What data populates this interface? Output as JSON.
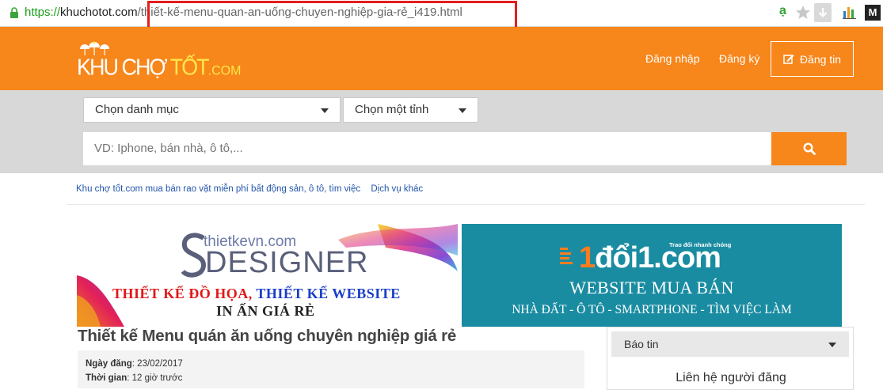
{
  "browser": {
    "url_scheme": "https://",
    "url_host": "khuchotot.com",
    "url_path": "/thiết-kế-menu-quan-an-uống-chuyen-nghiệp-gia-rẻ_i419.html"
  },
  "header": {
    "logo_main": "KHU CHỢ ",
    "logo_tot": "TỐT",
    "logo_com": ".COM",
    "login": "Đăng nhập",
    "register": "Đăng ký",
    "post": "Đăng tin"
  },
  "search": {
    "category_label": "Chọn danh mục",
    "province_label": "Chọn một tỉnh",
    "placeholder": "VD: Iphone, bán nhà, ô tô,..."
  },
  "breadcrumb": {
    "home": "Khu chợ tốt.com mua bán rao vặt miễn phí bất động sản, ô tô, tìm việc",
    "current": "Dịch vụ khác"
  },
  "banner_left": {
    "site": "thietkevn.com",
    "brand": "DESIGNER",
    "line1_red": "THIẾT KẾ ĐỒ HỌA, ",
    "line1_blue": "THIẾT KẾ WEBSITE",
    "line2": "IN ẤN GIÁ RẺ"
  },
  "banner_right": {
    "logo_a": "đổi",
    "logo_b": "1",
    "logo_c": ".com",
    "tagline": "Trao đổi nhanh chóng",
    "title": "WEBSITE MUA BÁN",
    "subtitle": "NHÀ ĐẤT - Ô TÔ - SMARTPHONE - TÌM VIỆC LÀM"
  },
  "listing": {
    "title": "Thiết kế Menu quán ăn uống chuyên nghiệp giá rẻ",
    "date_label": "Ngày đăng",
    "date_value": ": 23/02/2017",
    "time_label": "Thời gian",
    "time_value": ": 12 giờ trước"
  },
  "sidebar": {
    "report": "Báo tin",
    "contact": "Liên hệ người đăng"
  },
  "colors": {
    "brand_orange": "#f7861b",
    "banner_teal": "#1a8ca2",
    "highlight_red": "#e41e1e"
  }
}
